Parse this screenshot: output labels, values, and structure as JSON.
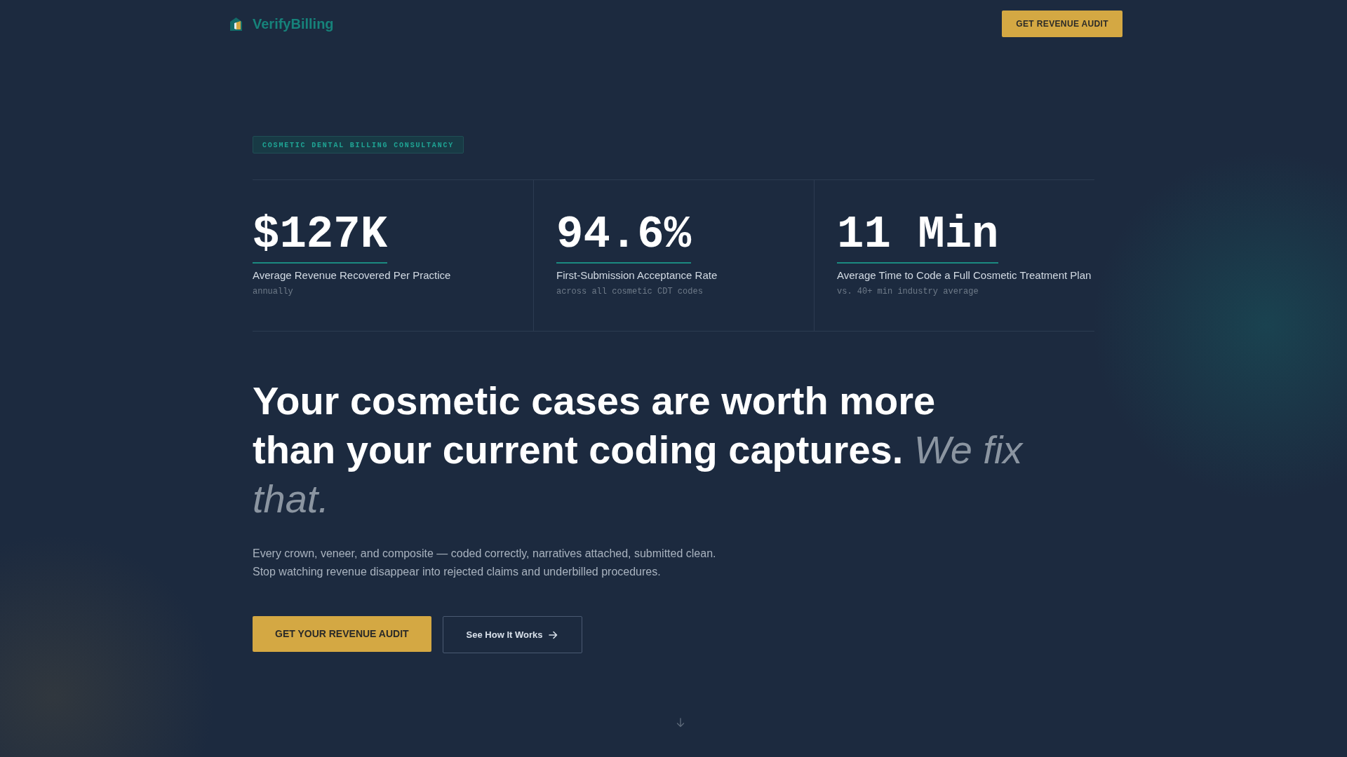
{
  "header": {
    "logo": {
      "name": "VerifyBilling"
    },
    "cta": "GET REVENUE AUDIT"
  },
  "hero": {
    "badge": "COSMETIC DENTAL BILLING CONSULTANCY",
    "stats": [
      {
        "value": "$127K",
        "label": "Average Revenue Recovered Per Practice",
        "note": "annually"
      },
      {
        "value": "94.6%",
        "label": "First-Submission Acceptance Rate",
        "note": "across all cosmetic CDT codes"
      },
      {
        "value": "11 Min",
        "label": "Average Time to Code a Full Cosmetic Treatment Plan",
        "note": "vs. 40+ min industry average"
      }
    ],
    "heading": "Your cosmetic cases are worth more than your current coding captures. *We fix that.*",
    "description": "Every crown, veneer, and composite — coded correctly, narratives attached, submitted clean. Stop watching revenue disappear into rejected claims and underbilled procedures.",
    "buttons": [
      {
        "kind": "primary",
        "label": "GET YOUR REVENUE AUDIT"
      },
      {
        "kind": "outline",
        "label": "See How It Works"
      }
    ]
  }
}
